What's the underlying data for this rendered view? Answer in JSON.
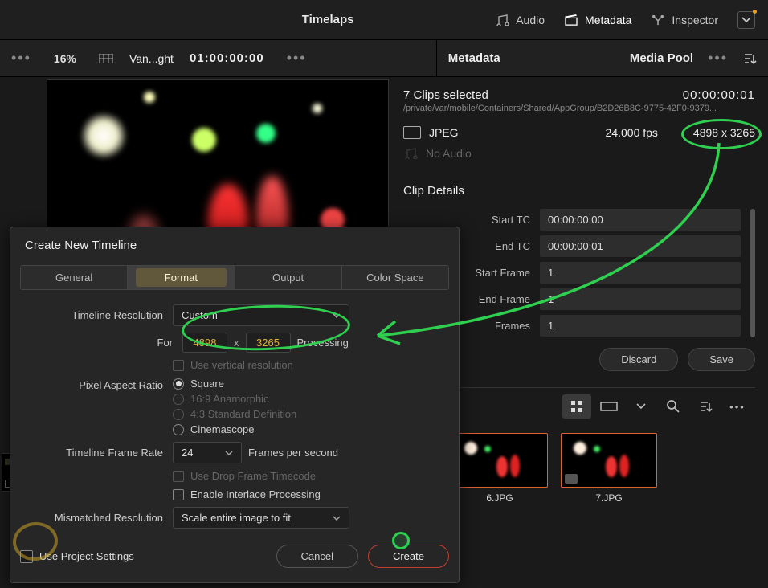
{
  "topbar": {
    "title": "Timelaps",
    "tools": {
      "audio": "Audio",
      "metadata": "Metadata",
      "inspector": "Inspector"
    }
  },
  "subbar": {
    "zoom": "16%",
    "clip_name": "Van...ght",
    "timecode": "01:00:00:00",
    "metadata_label": "Metadata",
    "media_pool_label": "Media Pool"
  },
  "metadata_panel": {
    "selection": "7 Clips selected",
    "duration_tc": "00:00:00:01",
    "path": "/private/var/mobile/Containers/Shared/AppGroup/B2D26B8C-9775-42F0-9379...",
    "format": "JPEG",
    "fps": "24.000 fps",
    "resolution": "4898 x 3265",
    "no_audio": "No Audio",
    "details_header": "Clip Details",
    "fields": {
      "start_tc": {
        "label": "Start TC",
        "value": "00:00:00:00"
      },
      "end_tc": {
        "label": "End TC",
        "value": "00:00:00:01"
      },
      "start_frame": {
        "label": "Start Frame",
        "value": "1"
      },
      "end_frame": {
        "label": "End Frame",
        "value": "1"
      },
      "frames": {
        "label": "Frames",
        "value": "1"
      }
    },
    "actions": {
      "discard": "Discard",
      "save": "Save"
    }
  },
  "thumbs": [
    "6.JPG",
    "7.JPG"
  ],
  "dialog": {
    "title": "Create New Timeline",
    "tabs": {
      "general": "General",
      "format": "Format",
      "output": "Output",
      "colorspace": "Color Space"
    },
    "timeline_res": {
      "label": "Timeline Resolution",
      "value": "Custom"
    },
    "for_label": "For",
    "width": "4898",
    "height": "3265",
    "processing": "Processing",
    "use_vertical": "Use vertical resolution",
    "par_label": "Pixel Aspect Ratio",
    "par_options": {
      "square": "Square",
      "anamorphic": "16:9 Anamorphic",
      "sd": "4:3 Standard Definition",
      "cinemascope": "Cinemascope"
    },
    "frame_rate_label": "Timeline Frame Rate",
    "frame_rate": "24",
    "fps_suffix": "Frames per second",
    "drop_frame": "Use Drop Frame Timecode",
    "interlace": "Enable Interlace Processing",
    "mismatched_label": "Mismatched Resolution",
    "mismatched_value": "Scale entire image to fit",
    "use_project": "Use Project Settings",
    "cancel": "Cancel",
    "create": "Create"
  }
}
